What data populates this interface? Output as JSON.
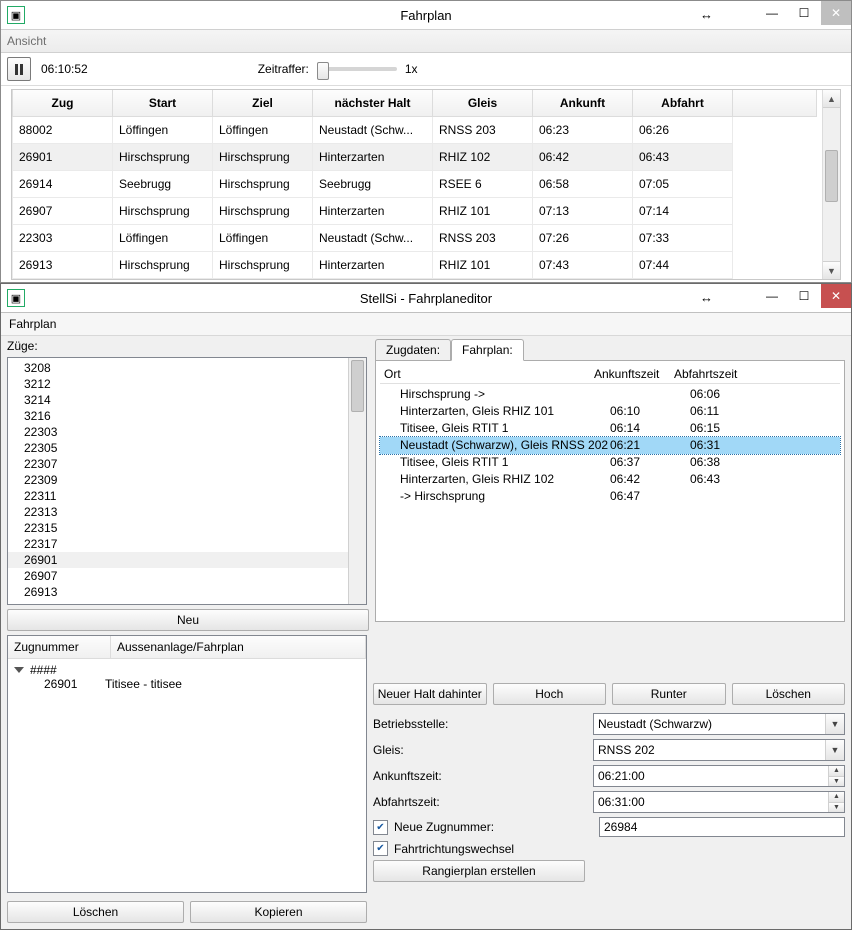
{
  "win1": {
    "title": "Fahrplan",
    "menu_view": "Ansicht",
    "clock": "06:10:52",
    "time_label": "Zeitraffer:",
    "time_factor": "1x",
    "headers": [
      "Zug",
      "Start",
      "Ziel",
      "nächster Halt",
      "Gleis",
      "Ankunft",
      "Abfahrt"
    ],
    "rows": [
      {
        "zug": "88002",
        "start": "Löffingen",
        "ziel": "Löffingen",
        "next": "Neustadt (Schw...",
        "gleis": "RNSS 203",
        "ank": "06:23",
        "abf": "06:26",
        "sel": false
      },
      {
        "zug": "26901",
        "start": "Hirschsprung",
        "ziel": "Hirschsprung",
        "next": "Hinterzarten",
        "gleis": "RHIZ 102",
        "ank": "06:42",
        "abf": "06:43",
        "sel": true
      },
      {
        "zug": "26914",
        "start": "Seebrugg",
        "ziel": "Hirschsprung",
        "next": "Seebrugg",
        "gleis": "RSEE 6",
        "ank": "06:58",
        "abf": "07:05",
        "sel": false
      },
      {
        "zug": "26907",
        "start": "Hirschsprung",
        "ziel": "Hirschsprung",
        "next": "Hinterzarten",
        "gleis": "RHIZ 101",
        "ank": "07:13",
        "abf": "07:14",
        "sel": false
      },
      {
        "zug": "22303",
        "start": "Löffingen",
        "ziel": "Löffingen",
        "next": "Neustadt (Schw...",
        "gleis": "RNSS 203",
        "ank": "07:26",
        "abf": "07:33",
        "sel": false
      },
      {
        "zug": "26913",
        "start": "Hirschsprung",
        "ziel": "Hirschsprung",
        "next": "Hinterzarten",
        "gleis": "RHIZ 101",
        "ank": "07:43",
        "abf": "07:44",
        "sel": false
      }
    ]
  },
  "win2": {
    "title": "StellSi - Fahrplaneditor",
    "menu_file": "Fahrplan",
    "left": {
      "zuege_label": "Züge:",
      "zuege": [
        "3208",
        "3212",
        "3214",
        "3216",
        "22303",
        "22305",
        "22307",
        "22309",
        "22311",
        "22313",
        "22315",
        "22317",
        "26901",
        "26907",
        "26913"
      ],
      "zuege_selected": "26901",
      "neu_btn": "Neu",
      "tree_hdr1": "Zugnummer",
      "tree_hdr2": "Aussenanlage/Fahrplan",
      "tree_root": "####",
      "tree_child_num": "26901",
      "tree_child_txt": "Titisee - titisee",
      "delete_btn": "Löschen",
      "copy_btn": "Kopieren"
    },
    "right": {
      "tab1": "Zugdaten:",
      "tab2": "Fahrplan:",
      "stops_hdr": [
        "Ort",
        "Ankunftszeit",
        "Abfahrtszeit"
      ],
      "stops": [
        {
          "ort": "Hirschsprung ->",
          "ank": "",
          "abf": "06:06",
          "sel": false
        },
        {
          "ort": "Hinterzarten, Gleis RHIZ 101",
          "ank": "06:10",
          "abf": "06:11",
          "sel": false
        },
        {
          "ort": "Titisee, Gleis RTIT 1",
          "ank": "06:14",
          "abf": "06:15",
          "sel": false
        },
        {
          "ort": "Neustadt (Schwarzw), Gleis RNSS 202",
          "ank": "06:21",
          "abf": "06:31",
          "sel": true
        },
        {
          "ort": "Titisee, Gleis RTIT 1",
          "ank": "06:37",
          "abf": "06:38",
          "sel": false
        },
        {
          "ort": "Hinterzarten, Gleis RHIZ 102",
          "ank": "06:42",
          "abf": "06:43",
          "sel": false
        },
        {
          "ort": "-> Hirschsprung",
          "ank": "06:47",
          "abf": "",
          "sel": false
        }
      ],
      "btn_after": "Neuer Halt dahinter",
      "btn_up": "Hoch",
      "btn_down": "Runter",
      "btn_del": "Löschen",
      "lbl_station": "Betriebsstelle:",
      "val_station": "Neustadt (Schwarzw)",
      "lbl_track": "Gleis:",
      "val_track": "RNSS 202",
      "lbl_arr": "Ankunftszeit:",
      "val_arr": "06:21:00",
      "lbl_dep": "Abfahrtszeit:",
      "val_dep": "06:31:00",
      "chk_newnum": "Neue Zugnummer:",
      "val_newnum": "26984",
      "chk_reverse": "Fahrtrichtungswechsel",
      "btn_rangier": "Rangierplan erstellen"
    }
  }
}
